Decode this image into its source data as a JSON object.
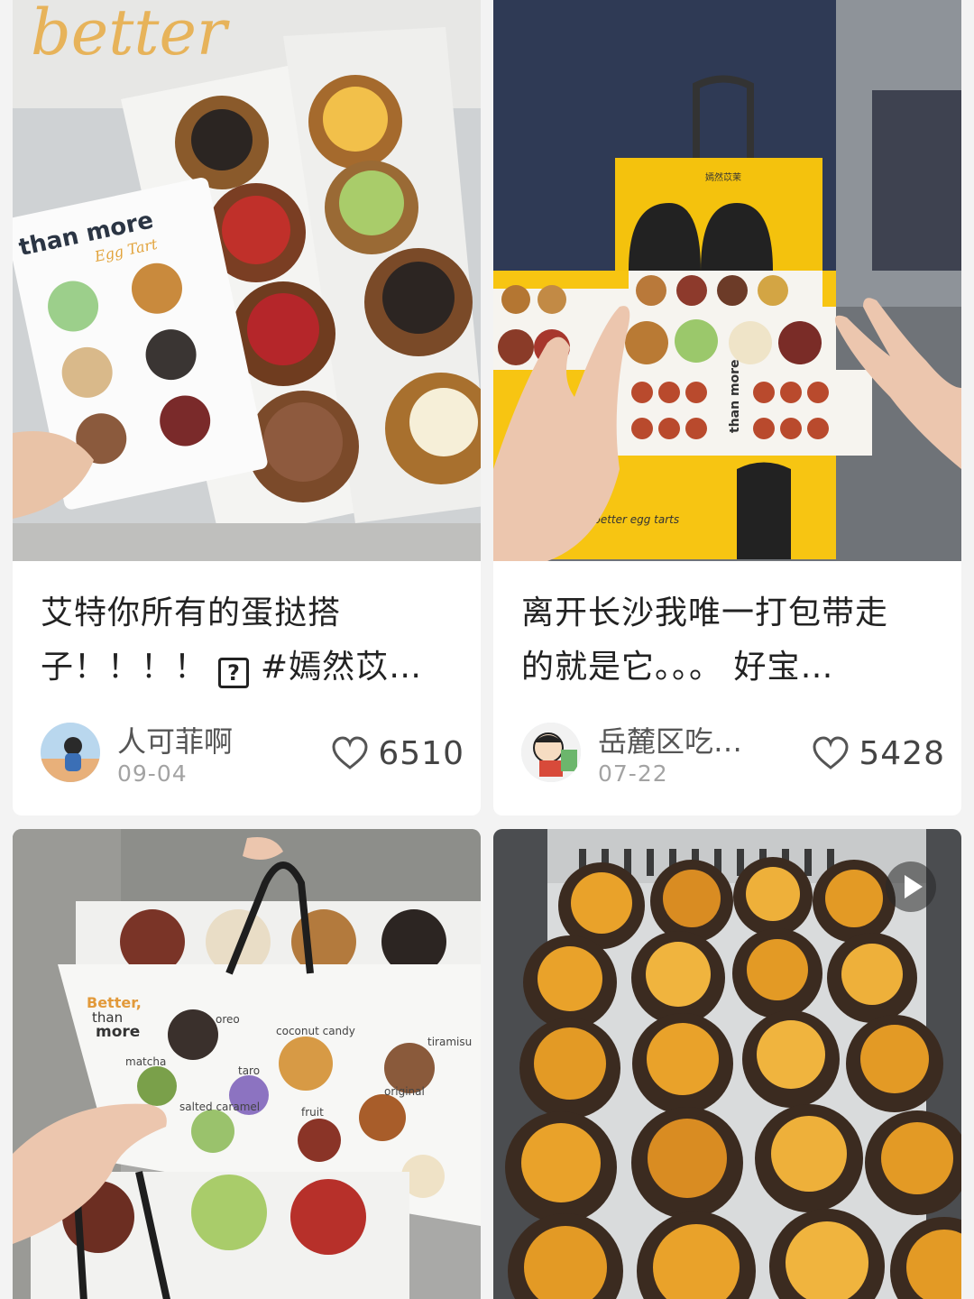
{
  "feed": {
    "cards": [
      {
        "title_line1": "艾特你所有的蛋挞搭",
        "title_line2_a": "子！！！！",
        "title_line2_b": "#嫣然苡…",
        "photo_text": {
          "brand": "than more",
          "script": "Egg Tart",
          "big_letters": "better"
        },
        "author": "人可菲啊",
        "date": "09-04",
        "likes": "6510"
      },
      {
        "title_line1": "离开长沙我唯一打包带走",
        "title_line2": "的就是它。。。 好宝…",
        "photo_text": {
          "bag": "嫣然苡茉",
          "box": "e better egg tarts",
          "menu": "than more"
        },
        "author": "岳麓区吃…",
        "date": "07-22",
        "likes": "5428"
      },
      {
        "photo_text": {
          "brand_a": "Better,",
          "brand_b": "than",
          "brand_c": "more",
          "f1": "oreo",
          "f2": "coconut candy",
          "f3": "matcha",
          "f4": "taro",
          "f5": "tiramisu",
          "f6": "salted caramel",
          "f7": "fruit",
          "f8": "original"
        }
      },
      {
        "is_video": true
      }
    ]
  },
  "colors": {
    "background": "#f3f3f3",
    "card": "#ffffff",
    "text": "#222222",
    "muted": "#a3a3a3",
    "bag_yellow": "#f4c20d",
    "tart_gold": "#e9a22a"
  }
}
